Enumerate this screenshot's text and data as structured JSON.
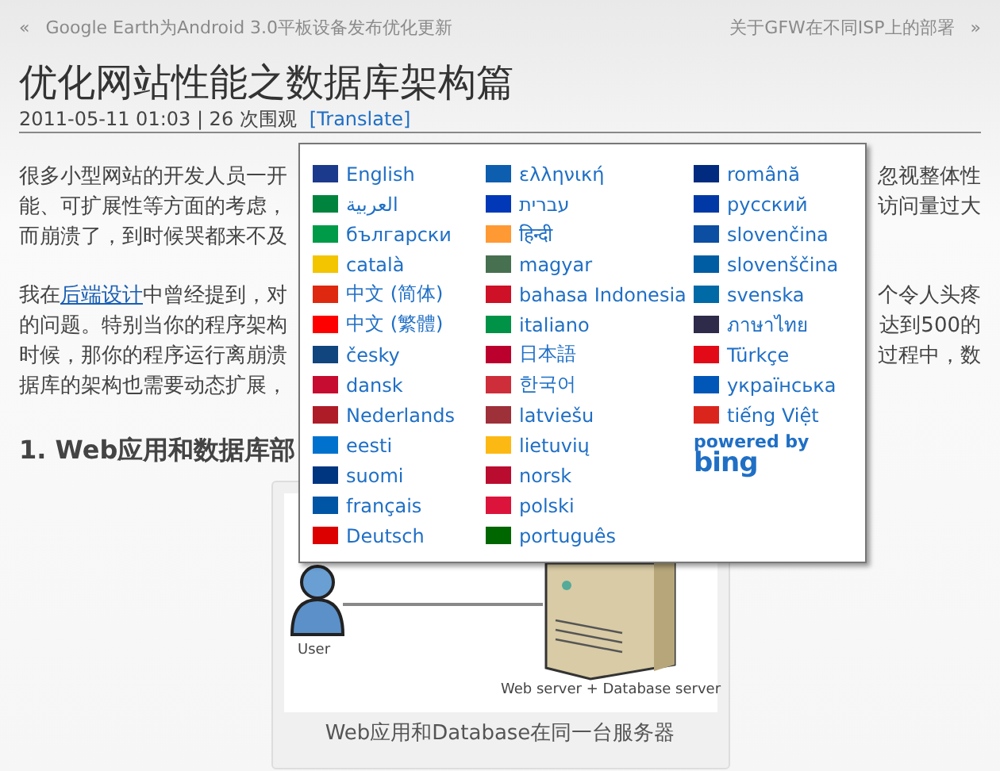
{
  "nav": {
    "prev": {
      "arrow": "«",
      "title": "Google Earth为Android 3.0平板设备发布优化更新"
    },
    "next": {
      "title": "关于GFW在不同ISP上的部署",
      "arrow": "»"
    }
  },
  "post": {
    "title": "优化网站性能之数据库架构篇",
    "meta": "2011-05-11 01:03 | 26 次围观",
    "translate": "[Translate]",
    "paragraphs": [
      [
        {
          "left": "很多小型网站的开发人员一开",
          "right": "忽视整体性"
        },
        {
          "left": "能、可扩展性等方面的考虑，",
          "right": "访问量过大"
        },
        {
          "left": "而崩溃了，到时候哭都来不及"
        }
      ],
      [
        {
          "left": "我在",
          "link": "后端设计",
          "after": "中曾经提到，对",
          "right": "个令人头疼"
        },
        {
          "left": "的问题。特别当你的程序架构",
          "right": "达到500的"
        },
        {
          "left": "时候，那你的程序运行离崩溃",
          "right": "过程中，数"
        },
        {
          "left": "据库的架构也需要动态扩展，"
        }
      ]
    ],
    "heading": "1. Web应用和数据库部",
    "figure": {
      "user_label": "User",
      "server_label": "Web server + Database server",
      "caption": "Web应用和Database在同一台服务器"
    }
  },
  "translate_menu": {
    "columns": [
      [
        {
          "label": "English",
          "color": "#1c3a8c"
        },
        {
          "label": "العربية",
          "color": "#00843d"
        },
        {
          "label": "български",
          "color": "#009b48"
        },
        {
          "label": "català",
          "color": "#f2c500"
        },
        {
          "label": "中文 (简体)",
          "color": "#de2910"
        },
        {
          "label": "中文 (繁體)",
          "color": "#fe0000"
        },
        {
          "label": "česky",
          "color": "#11457e"
        },
        {
          "label": "dansk",
          "color": "#c60c30"
        },
        {
          "label": "Nederlands",
          "color": "#ae1c28"
        },
        {
          "label": "eesti",
          "color": "#0072ce"
        },
        {
          "label": "suomi",
          "color": "#003580"
        },
        {
          "label": "français",
          "color": "#0055a4"
        },
        {
          "label": "Deutsch",
          "color": "#dd0000"
        }
      ],
      [
        {
          "label": "ελληνική",
          "color": "#0d5eaf"
        },
        {
          "label": "עברית",
          "color": "#0038b8"
        },
        {
          "label": "हिन्दी",
          "color": "#ff9933"
        },
        {
          "label": "magyar",
          "color": "#477050"
        },
        {
          "label": "bahasa Indonesia",
          "color": "#ce1126"
        },
        {
          "label": "italiano",
          "color": "#009246"
        },
        {
          "label": "日本語",
          "color": "#bc002d"
        },
        {
          "label": "한국어",
          "color": "#cd2e3a"
        },
        {
          "label": "latviešu",
          "color": "#9e3039"
        },
        {
          "label": "lietuvių",
          "color": "#fdb913"
        },
        {
          "label": "norsk",
          "color": "#ba0c2f"
        },
        {
          "label": "polski",
          "color": "#dc143c"
        },
        {
          "label": "português",
          "color": "#006600"
        }
      ],
      [
        {
          "label": "română",
          "color": "#002b7f"
        },
        {
          "label": "русский",
          "color": "#0039a6"
        },
        {
          "label": "slovenčina",
          "color": "#0b4ea2"
        },
        {
          "label": "slovenščina",
          "color": "#005da4"
        },
        {
          "label": "svenska",
          "color": "#006aa7"
        },
        {
          "label": "ภาษาไทย",
          "color": "#2d2a4a"
        },
        {
          "label": "Türkçe",
          "color": "#e30a17"
        },
        {
          "label": "українська",
          "color": "#0057b7"
        },
        {
          "label": "tiếng Việt",
          "color": "#da251d"
        }
      ]
    ],
    "powered_by": "powered by",
    "logo": "bing"
  }
}
